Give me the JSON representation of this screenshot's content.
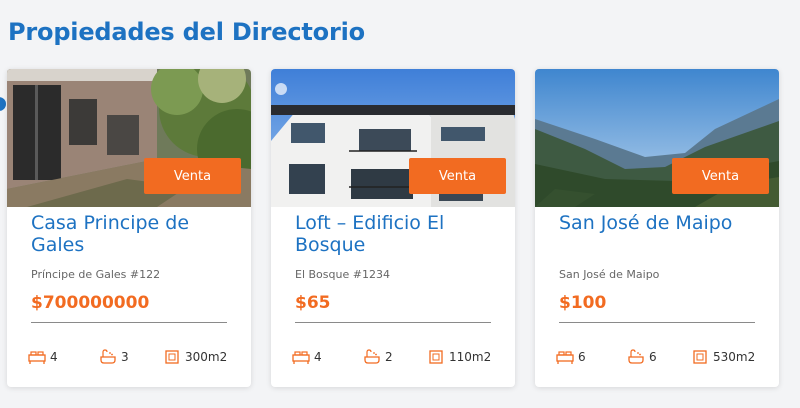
{
  "section_title": "Propiedades del Directorio",
  "colors": {
    "brand_blue": "#1d72c2",
    "accent_orange": "#f26b21"
  },
  "properties": [
    {
      "badge": "Venta",
      "title": "Casa Principe de Gales",
      "address": "Príncipe de Gales #122",
      "price": "$700000000",
      "bedrooms": "4",
      "bathrooms": "3",
      "area": "300m2"
    },
    {
      "badge": "Venta",
      "title": "Loft – Edificio El Bosque",
      "address": "El Bosque #1234",
      "price": "$65",
      "bedrooms": "4",
      "bathrooms": "2",
      "area": "110m2"
    },
    {
      "badge": "Venta",
      "title": "San José de Maipo",
      "address": "San José de Maipo",
      "price": "$100",
      "bedrooms": "6",
      "bathrooms": "6",
      "area": "530m2"
    }
  ],
  "icons": {
    "bed": "bed-icon",
    "bath": "bathtub-icon",
    "area": "area-icon"
  }
}
